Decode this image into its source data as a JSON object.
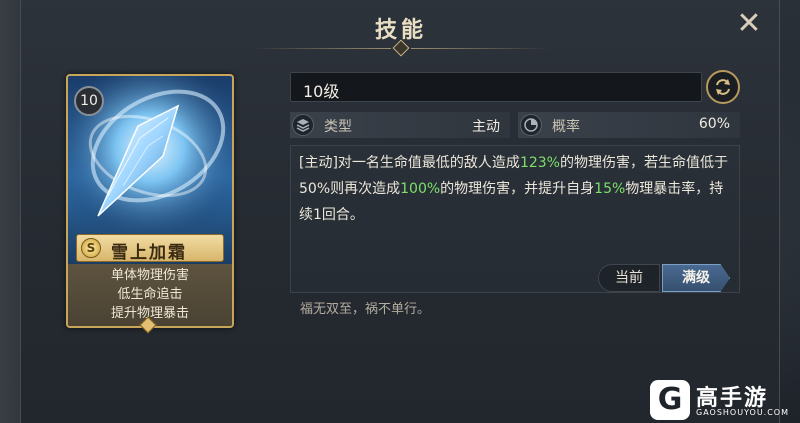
{
  "header": {
    "title": "技能",
    "close_icon": "close-icon"
  },
  "card": {
    "level": "10",
    "grade": "S",
    "name": "雪上加霜",
    "desc_lines": [
      "单体物理伤害",
      "低生命追击",
      "提升物理暴击"
    ]
  },
  "detail": {
    "level_label": "10级",
    "stats": [
      {
        "icon": "layers-icon",
        "label": "类型",
        "value": "主动"
      },
      {
        "icon": "probability-icon",
        "label": "概率",
        "value": "60%"
      }
    ],
    "description": {
      "p1": "[主动]对一名生命值最低的敌人造成",
      "v1": "123%",
      "p2": "的物理伤害，若生命值低于50%则再次造成",
      "v2": "100%",
      "p3": "的物理伤害，并提升自身",
      "v3": "15%",
      "p4": "物理暴击率，持续1回合。"
    },
    "tabs": {
      "current": "当前",
      "max": "满级"
    },
    "flavor": "福无双至，祸不单行。"
  },
  "watermark": {
    "name": "高手游",
    "url": "GAOSHOUYOU.COM"
  },
  "colors": {
    "highlight": "#7ee06a",
    "gold": "#c9a55a",
    "tab_active": "#4a6a92"
  }
}
